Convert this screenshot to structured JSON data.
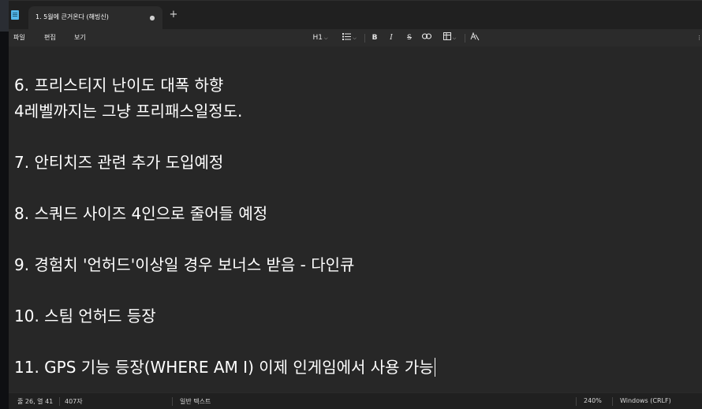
{
  "tab": {
    "title": "1. 5월에 큰거온다 (해빙신)",
    "dirty_marker": "●",
    "new_tab": "+"
  },
  "menu": {
    "file": "파일",
    "edit": "편집",
    "view": "보기"
  },
  "toolbar": {
    "heading": "H1",
    "bold": "B",
    "italic": "I",
    "strike": "S",
    "chevron": "⌵"
  },
  "content": {
    "lines": [
      "6. 프리스티지 난이도 대폭 하향",
      "4레벨까지는 그냥 프리패스일정도.",
      "7. 안티치즈 관련 추가 도입예정",
      "8. 스쿼드 사이즈 4인으로 줄어들 예정",
      "9. 경험치 '언허드'이상일 경우 보너스 받음 - 다인큐",
      "10. 스팀 언허드 등장",
      "11. GPS 기능 등장(WHERE AM I) 이제 인게임에서 사용 가능"
    ]
  },
  "status": {
    "position": "줄 26, 열 41",
    "chars": "407자",
    "format": "일반 텍스트",
    "zoom": "240%",
    "line_ending": "Windows (CRLF)"
  },
  "colors": {
    "editor_bg": "#272727",
    "toolbar_bg": "#2b2b2b",
    "titlebar_bg": "#202020",
    "text": "#ffffff",
    "app_icon": "#55b7e8"
  }
}
